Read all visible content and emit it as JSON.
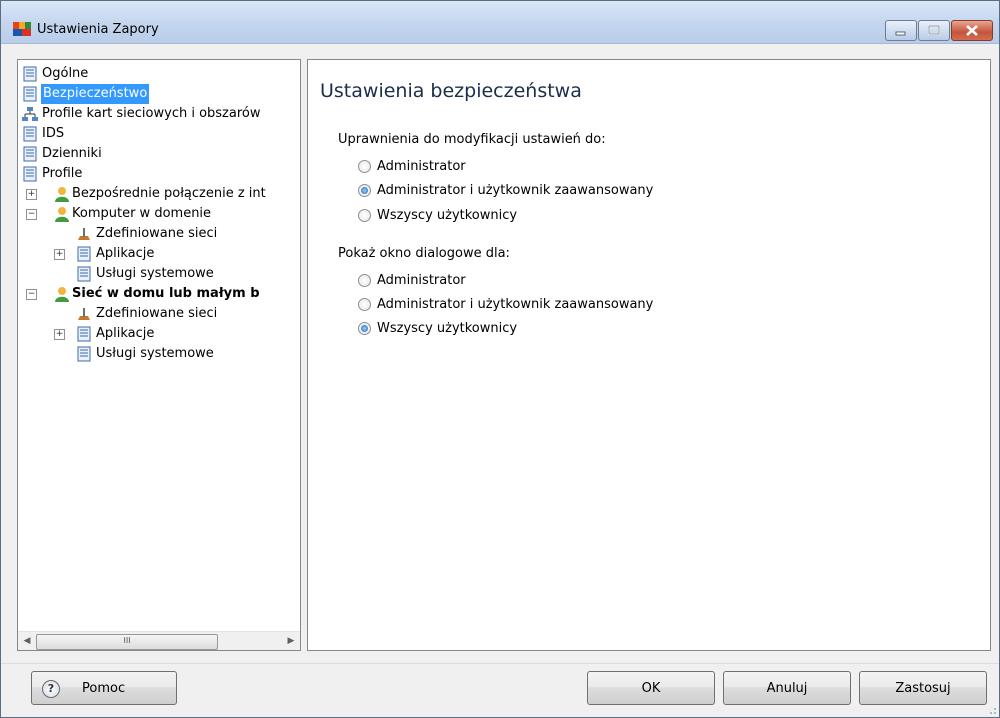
{
  "window": {
    "title": "Ustawienia Zapory"
  },
  "tree": {
    "items": [
      {
        "label": "Ogólne"
      },
      {
        "label": "Bezpieczeństwo"
      },
      {
        "label": "Profile kart sieciowych i obszarów"
      },
      {
        "label": "IDS"
      },
      {
        "label": "Dzienniki"
      },
      {
        "label": "Profile"
      },
      {
        "label": "Bezpośrednie połączenie z int"
      },
      {
        "label": "Komputer w domenie"
      },
      {
        "label": "Zdefiniowane sieci"
      },
      {
        "label": "Aplikacje"
      },
      {
        "label": "Usługi systemowe"
      },
      {
        "label": "Sieć w domu lub małym b"
      },
      {
        "label": "Zdefiniowane sieci"
      },
      {
        "label": "Aplikacje"
      },
      {
        "label": "Usługi systemowe"
      }
    ],
    "selected": "Bezpieczeństwo",
    "scroll_thumb": "III"
  },
  "panel": {
    "title": "Ustawienia bezpieczeństwa",
    "group1": {
      "label": "Uprawnienia do modyfikacji ustawień do:",
      "options": [
        "Administrator",
        "Administrator i użytkownik zaawansowany",
        "Wszyscy użytkownicy"
      ],
      "selected": "Administrator i użytkownik zaawansowany"
    },
    "group2": {
      "label": "Pokaż okno dialogowe dla:",
      "options": [
        "Administrator",
        "Administrator i użytkownik zaawansowany",
        "Wszyscy użytkownicy"
      ],
      "selected": "Wszyscy użytkownicy"
    }
  },
  "buttons": {
    "help": "Pomoc",
    "ok": "OK",
    "cancel": "Anuluj",
    "apply": "Zastosuj"
  }
}
